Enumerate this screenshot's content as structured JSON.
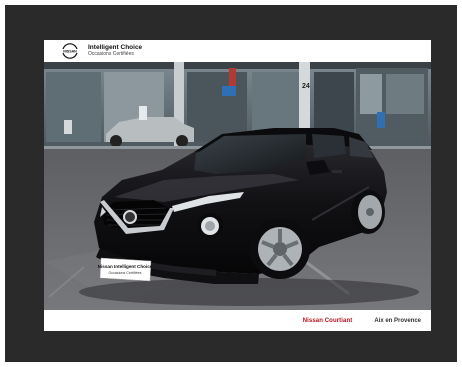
{
  "header": {
    "logo_text": "NISSAN",
    "title": "Intelligent Choice",
    "subtitle": "Occasions Certifiées"
  },
  "scene": {
    "building_number": "24",
    "plate_line1": "Nissan Intelligent Choice",
    "plate_line2": "Occasions Certifiées",
    "car_color": "#111114"
  },
  "footer": {
    "dealer_name": "Nissan Courtiant",
    "location": "Aix en Provence"
  },
  "colors": {
    "frame": "#2a2a2a",
    "brand_red": "#b5121b",
    "asphalt": "#6b6c70"
  }
}
